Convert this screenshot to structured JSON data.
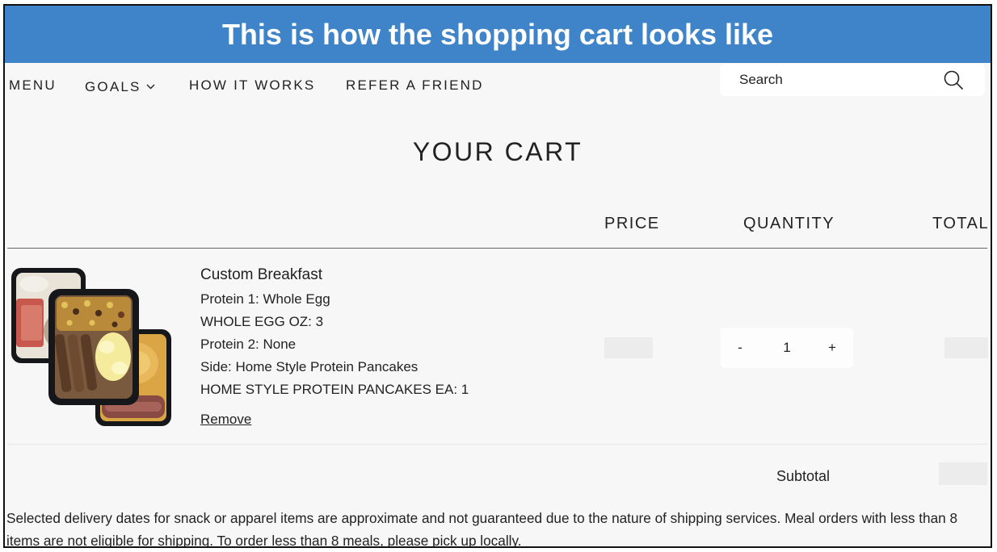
{
  "banner": {
    "title": "This is how the shopping cart looks like",
    "bg_color": "#3f83c9"
  },
  "nav": {
    "items": [
      {
        "label": "MENU"
      },
      {
        "label": "GOALS",
        "icon": "chevron-down-icon"
      },
      {
        "label": "HOW IT WORKS"
      },
      {
        "label": "REFER A FRIEND"
      }
    ]
  },
  "search": {
    "placeholder": "Search",
    "icon": "search-icon"
  },
  "cart": {
    "title": "YOUR CART",
    "columns": {
      "price": "PRICE",
      "quantity": "QUANTITY",
      "total": "TOTAL"
    },
    "item": {
      "name": "Custom Breakfast",
      "options": [
        "Protein 1: Whole Egg",
        "WHOLE EGG OZ: 3",
        "Protein 2: None",
        "Side: Home Style Protein Pancakes",
        "HOME STYLE PROTEIN PANCAKES EA: 1"
      ],
      "remove_label": "Remove",
      "quantity": "1",
      "decrement_label": "-",
      "increment_label": "+"
    },
    "subtotal_label": "Subtotal",
    "note": "Selected delivery dates for snack or apparel items are approximate and not guaranteed due to the nature of shipping services. Meal orders with less than 8 items are not eligible for shipping. To order less than 8 meals, please pick up locally."
  }
}
